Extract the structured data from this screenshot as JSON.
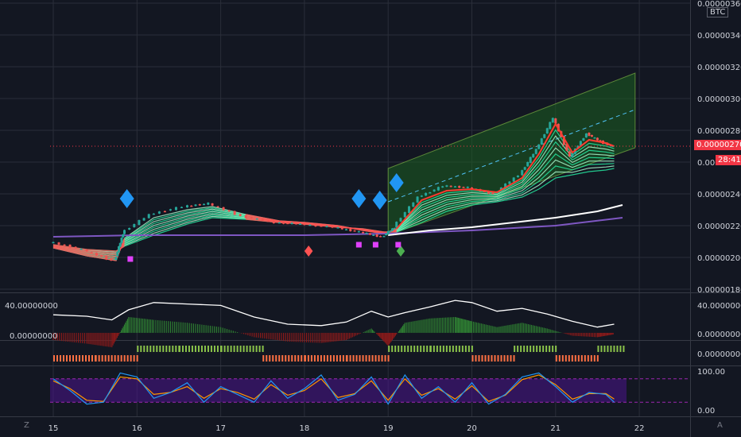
{
  "header": {
    "currency_label": "BTC"
  },
  "price_axis": {
    "ticks": [
      "0.00000360",
      "0.00000340",
      "0.00000320",
      "0.00000300",
      "0.00000280",
      "0.00000260",
      "0.00000240",
      "0.00000220",
      "0.00000200",
      "0.00000180"
    ],
    "current_price": "0.00000270",
    "countdown": "28:41"
  },
  "time_axis": {
    "ticks": [
      "15",
      "16",
      "17",
      "18",
      "19",
      "20",
      "21",
      "22"
    ]
  },
  "osc_panel": {
    "ticks": [
      "40.00000000",
      "0.00000000"
    ]
  },
  "bars_panel": {
    "tick": "0.00000000"
  },
  "stoch_panel": {
    "ticks": [
      "100.00",
      "0.00"
    ]
  },
  "corner_labels": {
    "left": "Z",
    "right": "A"
  },
  "colors": {
    "background": "#131722",
    "grid": "#2a2e39",
    "candle_up": "#26a69a",
    "candle_down": "#ef5350",
    "ribbon_bull": "#26e8a0",
    "ribbon_bear": "#ff5252",
    "white_ma": "#ffffff",
    "purple_ma": "#7e57c2",
    "channel": "#1b5e20",
    "diamond_blue": "#2196f3",
    "signal_magenta": "#e040fb",
    "price_line": "#f23645"
  },
  "chart_data": [
    {
      "type": "line",
      "name": "price",
      "x": [
        15.0,
        15.4,
        15.75,
        15.85,
        16.2,
        16.6,
        16.9,
        17.3,
        17.7,
        18.0,
        18.4,
        18.7,
        18.95,
        19.1,
        19.4,
        19.7,
        20.0,
        20.3,
        20.6,
        20.8,
        21.0,
        21.2,
        21.4,
        21.6,
        21.7
      ],
      "y": [
        2.1e-06,
        2.05e-06,
        1.98e-06,
        2.15e-06,
        2.27e-06,
        2.32e-06,
        2.34e-06,
        2.26e-06,
        2.22e-06,
        2.21e-06,
        2.19e-06,
        2.16e-06,
        2.13e-06,
        2.19e-06,
        2.38e-06,
        2.45e-06,
        2.44e-06,
        2.4e-06,
        2.52e-06,
        2.68e-06,
        2.88e-06,
        2.63e-06,
        2.78e-06,
        2.72e-06,
        2.7e-06
      ],
      "current_price": 2.7e-06,
      "ylim": [
        1.78e-06,
        3.62e-06
      ],
      "xlim": [
        14.95,
        22.5
      ],
      "ribbon_fast": [
        2.06e-06,
        2.01e-06,
        1.98e-06,
        2.12e-06,
        2.25e-06,
        2.3e-06,
        2.32e-06,
        2.27e-06,
        2.23e-06,
        2.22e-06,
        2.2e-06,
        2.17e-06,
        2.15e-06,
        2.18e-06,
        2.36e-06,
        2.42e-06,
        2.43e-06,
        2.41e-06,
        2.5e-06,
        2.65e-06,
        2.84e-06,
        2.66e-06,
        2.74e-06,
        2.72e-06,
        2.7e-06
      ],
      "ribbon_slow": [
        2.08e-06,
        2.05e-06,
        2.04e-06,
        2.07e-06,
        2.14e-06,
        2.21e-06,
        2.25e-06,
        2.24e-06,
        2.22e-06,
        2.21e-06,
        2.19e-06,
        2.18e-06,
        2.16e-06,
        2.16e-06,
        2.22e-06,
        2.29e-06,
        2.33e-06,
        2.35e-06,
        2.38e-06,
        2.43e-06,
        2.5e-06,
        2.52e-06,
        2.54e-06,
        2.55e-06,
        2.56e-06
      ],
      "white_ma": {
        "x": [
          19.0,
          19.5,
          20.0,
          20.5,
          21.0,
          21.5,
          21.8
        ],
        "y": [
          2.14e-06,
          2.17e-06,
          2.19e-06,
          2.22e-06,
          2.25e-06,
          2.29e-06,
          2.33e-06
        ]
      },
      "purple_ma": {
        "x": [
          15.0,
          16.0,
          17.0,
          18.0,
          19.0,
          20.0,
          21.0,
          21.8
        ],
        "y": [
          2.13e-06,
          2.14e-06,
          2.14e-06,
          2.14e-06,
          2.15e-06,
          2.17e-06,
          2.2e-06,
          2.25e-06
        ]
      },
      "channel": {
        "x": [
          19.0,
          21.95
        ],
        "upper": [
          2.56e-06,
          3.16e-06
        ],
        "mid": [
          2.35e-06,
          2.93e-06
        ],
        "lower": [
          2.14e-06,
          2.69e-06
        ]
      },
      "blue_diamonds": [
        {
          "x": 15.88,
          "y": 2.37e-06
        },
        {
          "x": 18.65,
          "y": 2.37e-06
        },
        {
          "x": 18.9,
          "y": 2.36e-06
        },
        {
          "x": 19.1,
          "y": 2.47e-06
        }
      ],
      "red_diamonds": [
        {
          "x": 18.05,
          "y": 2.04e-06
        }
      ],
      "green_diamonds": [
        {
          "x": 19.15,
          "y": 2.04e-06
        }
      ],
      "magenta_squares": [
        {
          "x": 15.92,
          "y": 1.99e-06
        },
        {
          "x": 18.65,
          "y": 2.08e-06
        },
        {
          "x": 18.85,
          "y": 2.08e-06
        },
        {
          "x": 19.12,
          "y": 2.08e-06
        }
      ]
    },
    {
      "type": "area",
      "name": "oscillator",
      "x": [
        15.0,
        15.4,
        15.7,
        15.9,
        16.2,
        16.6,
        17.0,
        17.4,
        17.8,
        18.2,
        18.5,
        18.8,
        19.0,
        19.2,
        19.5,
        19.8,
        20.0,
        20.3,
        20.6,
        20.9,
        21.2,
        21.5,
        21.7
      ],
      "line": [
        25,
        23,
        18,
        32,
        42,
        40,
        38,
        22,
        12,
        10,
        15,
        30,
        22,
        28,
        36,
        45,
        42,
        30,
        34,
        26,
        16,
        8,
        12
      ],
      "hist": [
        -10,
        -15,
        -20,
        22,
        18,
        14,
        8,
        -6,
        -12,
        -14,
        -10,
        6,
        -18,
        14,
        20,
        22,
        16,
        8,
        14,
        6,
        -4,
        -6,
        -2
      ],
      "ylim": [
        -10,
        55
      ]
    },
    {
      "type": "bar",
      "name": "signal_bars",
      "x": [
        15.0,
        15.5,
        16.0,
        16.5,
        17.0,
        17.5,
        18.0,
        18.5,
        19.0,
        19.5,
        20.0,
        20.5,
        21.0,
        21.5
      ],
      "values": [
        -1,
        -1,
        1,
        1,
        1,
        -1,
        -1,
        -1,
        1,
        1,
        -1,
        1,
        -1,
        1
      ]
    },
    {
      "type": "line",
      "name": "stochastic",
      "x": [
        15.0,
        15.2,
        15.4,
        15.6,
        15.8,
        16.0,
        16.2,
        16.4,
        16.6,
        16.8,
        17.0,
        17.2,
        17.4,
        17.6,
        17.8,
        18.0,
        18.2,
        18.4,
        18.6,
        18.8,
        19.0,
        19.2,
        19.4,
        19.6,
        19.8,
        20.0,
        20.2,
        20.4,
        20.6,
        20.8,
        21.0,
        21.2,
        21.4,
        21.6,
        21.7
      ],
      "k": [
        80,
        50,
        15,
        20,
        95,
        85,
        30,
        45,
        70,
        20,
        60,
        40,
        20,
        75,
        30,
        55,
        90,
        25,
        40,
        85,
        15,
        90,
        30,
        60,
        20,
        70,
        15,
        40,
        85,
        95,
        60,
        20,
        45,
        40,
        20
      ],
      "d": [
        75,
        55,
        25,
        22,
        85,
        80,
        40,
        45,
        60,
        30,
        55,
        45,
        28,
        65,
        38,
        50,
        80,
        32,
        42,
        75,
        25,
        80,
        38,
        55,
        28,
        62,
        22,
        38,
        78,
        90,
        65,
        28,
        42,
        42,
        28
      ],
      "bands": [
        80,
        20
      ],
      "ylim": [
        0,
        100
      ]
    }
  ]
}
